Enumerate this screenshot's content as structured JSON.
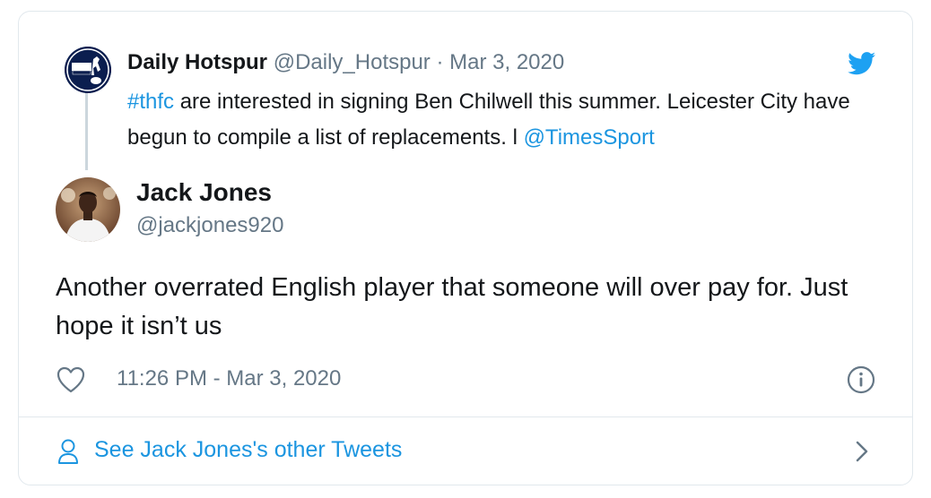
{
  "quoted_tweet": {
    "name": "Daily Hotspur",
    "handle": "@Daily_Hotspur",
    "separator": "·",
    "date": "Mar 3, 2020",
    "avatar_icon": "daily-hotspur-logo",
    "text_hashtag": "#thfc",
    "text_body": " are interested in signing Ben Chilwell this summer. Leicester City have begun to compile a list of replacements. l ",
    "text_mention": "@TimesSport"
  },
  "tweet": {
    "name": "Jack Jones",
    "handle": "@jackjones920",
    "text": "Another overrated English player that  someone will over pay for. Just hope it isn’t us",
    "timestamp": "11:26 PM - Mar 3, 2020"
  },
  "icons": {
    "brand": "twitter-bird-icon",
    "like": "heart-icon",
    "info": "info-icon",
    "profile": "person-icon",
    "more": "chevron-right-icon"
  },
  "footer": {
    "label": "See Jack Jones's other Tweets"
  },
  "colors": {
    "link": "#1b95e0",
    "secondary_text": "#657786",
    "border": "#e1e8ed",
    "twitter_blue": "#1da1f2"
  }
}
